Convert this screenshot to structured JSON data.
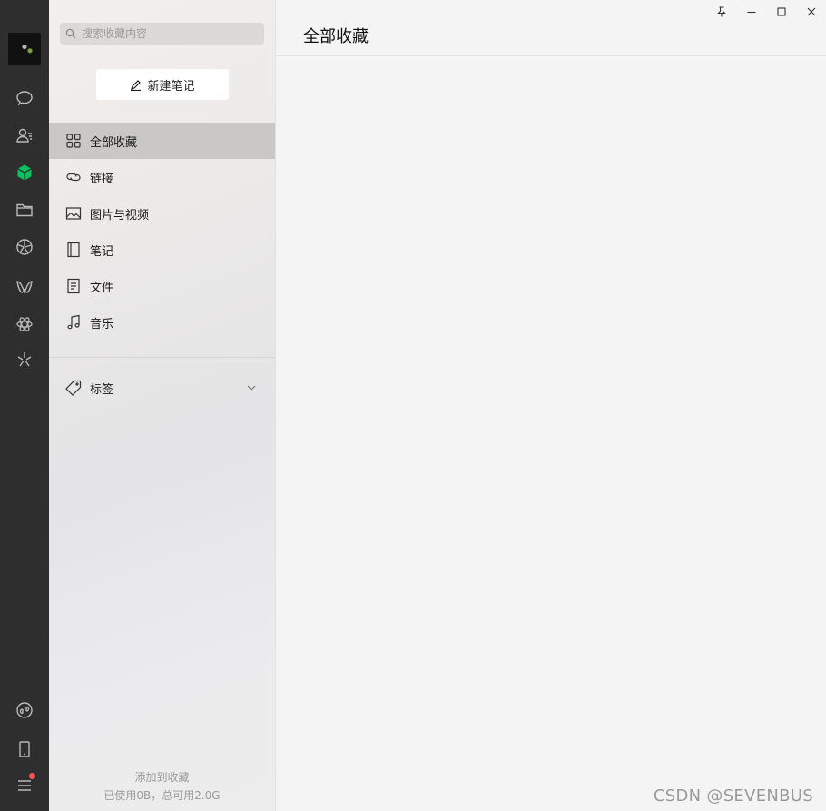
{
  "rail": {
    "icons": [
      "chat-icon",
      "contacts-icon",
      "favorites-icon",
      "folder-icon",
      "moments-icon",
      "channels-icon",
      "mini-programs-icon",
      "search-discover-icon",
      "mini-program-links-icon",
      "phone-icon",
      "menu-icon"
    ],
    "active_color": "#07c160",
    "badge_color": "#fa5151"
  },
  "search": {
    "placeholder": "搜索收藏内容"
  },
  "new_note_label": "新建笔记",
  "nav": [
    {
      "label": "全部收藏",
      "icon": "grid-icon",
      "active": true
    },
    {
      "label": "链接",
      "icon": "link-icon"
    },
    {
      "label": "图片与视频",
      "icon": "image-icon"
    },
    {
      "label": "笔记",
      "icon": "note-icon"
    },
    {
      "label": "文件",
      "icon": "file-icon"
    },
    {
      "label": "音乐",
      "icon": "music-icon"
    }
  ],
  "tags_label": "标签",
  "footer": {
    "add_label": "添加到收藏",
    "usage": "已使用0B，总可用2.0G"
  },
  "content": {
    "title": "全部收藏"
  },
  "window_controls": [
    "pin-icon",
    "minimize-icon",
    "maximize-icon",
    "close-icon"
  ],
  "watermark": "CSDN @SEVENBUS"
}
